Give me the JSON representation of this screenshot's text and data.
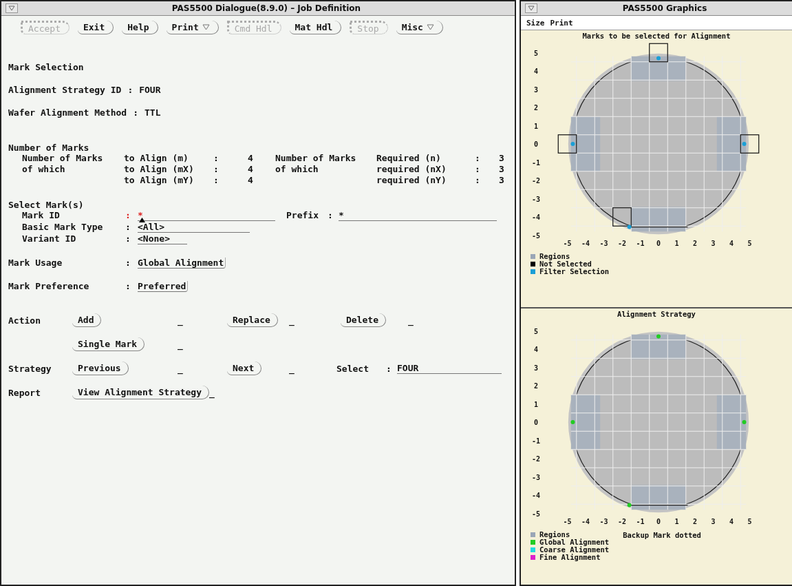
{
  "dialog": {
    "title": "PAS5500 Dialogue(8.9.0) – Job Definition",
    "toolbar": [
      {
        "label": "Accept",
        "disabled": true,
        "menu": false
      },
      {
        "label": "Exit",
        "disabled": false,
        "menu": false
      },
      {
        "label": "Help",
        "disabled": false,
        "menu": false
      },
      {
        "label": "Print",
        "disabled": false,
        "menu": true
      },
      {
        "label": "Cmd Hdl",
        "disabled": true,
        "menu": false
      },
      {
        "label": "Mat Hdl",
        "disabled": false,
        "menu": false
      },
      {
        "label": "Stop",
        "disabled": true,
        "menu": false
      },
      {
        "label": "Misc",
        "disabled": false,
        "menu": true
      }
    ],
    "section_title": "Mark Selection",
    "info": [
      {
        "label": "Alignment Strategy ID",
        "sep": ":",
        "value": "FOUR"
      },
      {
        "label": "Wafer Alignment Method",
        "sep": ":",
        "value": "TTL"
      }
    ],
    "number_of_marks": {
      "title": "Number of Marks",
      "rows": [
        {
          "left": {
            "group": "Number of Marks",
            "label": "to Align (m)",
            "sep": ":",
            "value": "4"
          },
          "right": {
            "group": "Number of Marks",
            "label": "Required (n)",
            "sep": ":",
            "value": "3"
          }
        },
        {
          "left": {
            "group": "of which",
            "label": "to Align (mX)",
            "sep": ":",
            "value": "4"
          },
          "right": {
            "group": "of which",
            "label": "required (nX)",
            "sep": ":",
            "value": "3"
          }
        },
        {
          "left": {
            "label": "to Align (mY)",
            "sep": ":",
            "value": "4"
          },
          "right": {
            "label": "required (nY)",
            "sep": ":",
            "value": "3"
          }
        }
      ]
    },
    "select_marks": {
      "title": "Select Mark(s)",
      "fields": [
        {
          "label": "Mark ID",
          "sep": ":",
          "value": "*",
          "focused": true
        },
        {
          "label": "Basic Mark Type",
          "sep": ":",
          "value": "<All>",
          "focused": false
        },
        {
          "label": "Variant ID",
          "sep": ":",
          "value": "<None>",
          "focused": false
        }
      ],
      "prefix": {
        "label": "Prefix",
        "sep": ":",
        "value": "*"
      }
    },
    "options": [
      {
        "label": "Mark Usage",
        "sep": ":",
        "value": "Global Alignment"
      },
      {
        "label": "Mark Preference",
        "sep": ":",
        "value": "Preferred"
      }
    ],
    "action_rows": [
      {
        "label": "Action",
        "buttons": [
          {
            "label": "Add",
            "marker": "_"
          },
          {
            "label": "Replace",
            "marker": "_"
          },
          {
            "label": "Delete",
            "marker": "_"
          }
        ]
      },
      {
        "buttons": [
          {
            "label": "Single Mark",
            "marker": "_"
          }
        ]
      },
      {
        "label": "Strategy",
        "buttons": [
          {
            "label": "Previous",
            "marker": "_"
          },
          {
            "label": "Next",
            "marker": "_"
          }
        ],
        "select": {
          "label": "Select",
          "sep": ":",
          "value": "FOUR"
        }
      },
      {
        "label": "Report",
        "buttons": [
          {
            "label": "View Alignment Strategy",
            "marker": "_"
          }
        ]
      }
    ]
  },
  "graphics": {
    "title": "PAS5500 Graphics",
    "menu": [
      "Size",
      "Print"
    ],
    "panels": [
      {
        "show_selection_boxes": true,
        "chart_data": {
          "type": "scatter",
          "title": "Marks to be selected for Alignment",
          "x": [
            0,
            -4.7,
            4.7,
            -1.6
          ],
          "xticks": [
            -5,
            -4,
            -3,
            -2,
            -1,
            0,
            1,
            2,
            3,
            4,
            5
          ],
          "yticks": [
            5,
            4,
            3,
            2,
            1,
            0,
            -1,
            -2,
            -3,
            -4,
            -5
          ],
          "xlim": [
            -5,
            5
          ],
          "ylim": [
            -5,
            5
          ],
          "series": [
            {
              "name": "Filter Selection",
              "color": "#1a9fd6",
              "values": [
                4.7,
                0,
                0,
                -4.55
              ]
            }
          ]
        },
        "legend": [
          {
            "label": "Regions",
            "color": "#9aa6b6"
          },
          {
            "label": "Not Selected",
            "color": "#000000"
          },
          {
            "kind": "series"
          }
        ]
      },
      {
        "show_selection_boxes": false,
        "chart_data": {
          "type": "scatter",
          "title": "Alignment Strategy",
          "x": [
            0,
            -4.7,
            4.7,
            -1.6
          ],
          "xticks": [
            -5,
            -4,
            -3,
            -2,
            -1,
            0,
            1,
            2,
            3,
            4,
            5
          ],
          "yticks": [
            5,
            4,
            3,
            2,
            1,
            0,
            -1,
            -2,
            -3,
            -4,
            -5
          ],
          "xlim": [
            -5,
            5
          ],
          "ylim": [
            -5,
            5
          ],
          "series": [
            {
              "name": "Global Alignment",
              "color": "#22cc22",
              "values": [
                4.7,
                0,
                0,
                -4.55
              ]
            }
          ]
        },
        "legend": [
          {
            "label": "Regions",
            "color": "#9aa6b6"
          },
          {
            "kind": "series"
          },
          {
            "label": "Coarse Alignment",
            "color": "#22dddd"
          },
          {
            "label": "Fine Alignment",
            "color": "#dd22cc"
          }
        ],
        "note": "Backup Mark dotted"
      }
    ]
  }
}
